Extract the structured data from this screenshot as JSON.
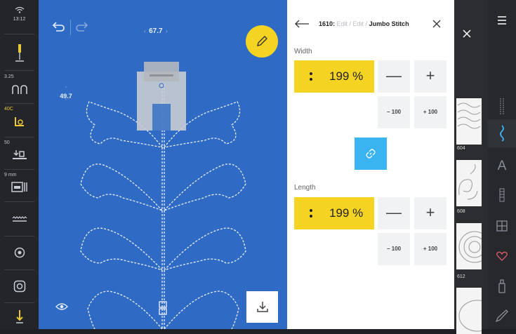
{
  "status": {
    "time": "13:12"
  },
  "left_toolbar": {
    "stitch_length_value": "3.25",
    "tension_value": "40C",
    "presser_foot_pressure_value": "50",
    "stitch_width_value": "9 mm"
  },
  "canvas": {
    "top_value": "67.7",
    "left_value": "49.7"
  },
  "panel": {
    "breadcrumb_num": "1610:",
    "breadcrumb_mid": " Edit / Edit / ",
    "breadcrumb_title": "Jumbo Stitch",
    "width_label": "Width",
    "width_value": "199 %",
    "length_label": "Length",
    "length_value": "199 %",
    "minus": "—",
    "plus": "+",
    "minus100": "− 100",
    "plus100": "+ 100"
  },
  "stitch_list": {
    "items": [
      {
        "number": "604"
      },
      {
        "number": "608"
      },
      {
        "number": "612"
      }
    ]
  },
  "colors": {
    "canvas_blue": "#2f6bc4",
    "accent_yellow": "#f5d323",
    "link_blue": "#39b4f0",
    "heart_red": "#e0596a"
  }
}
